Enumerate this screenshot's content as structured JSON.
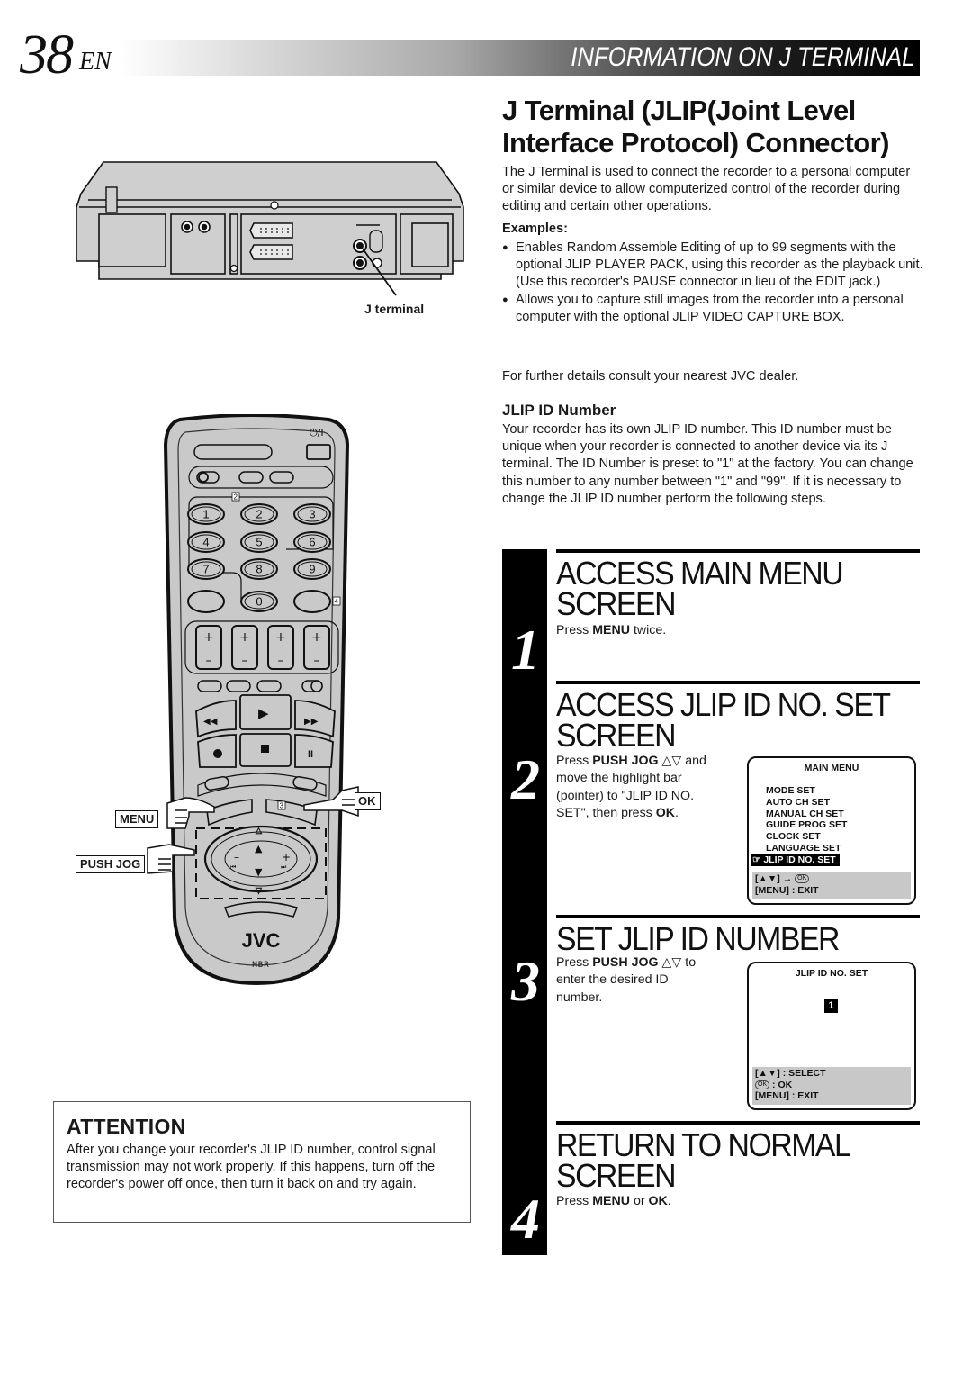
{
  "header": {
    "page_number": "38",
    "language": "EN",
    "section": "INFORMATION ON J TERMINAL"
  },
  "main": {
    "title_line1": "J Terminal (JLIP(Joint Level",
    "title_line2": "Interface Protocol) Connector)",
    "intro": "The J Terminal is used to connect the recorder to a personal computer or similar device to allow computerized control of the recorder during editing and certain other operations.",
    "examples_heading": "Examples:",
    "examples": [
      "Enables Random Assemble Editing of up to 99 segments with the optional JLIP PLAYER PACK, using this recorder as the playback unit. (Use this recorder's PAUSE connector in lieu of the EDIT jack.)",
      "Allows you to capture still images from the recorder into a personal computer with the optional JLIP VIDEO CAPTURE BOX."
    ],
    "further_details": "For further details consult your nearest JVC dealer.",
    "jlip_heading": "JLIP ID Number",
    "jlip_body": "Your recorder has its own JLIP ID number. This ID number must be unique when your recorder is connected to another device via its J terminal. The ID Number is preset to \"1\" at the factory. You can change this number to any number between \"1\" and \"99\". If it is necessary to change the JLIP ID number perform the following steps."
  },
  "steps": [
    {
      "number": "1",
      "title_line1": "ACCESS MAIN MENU",
      "title_line2": "SCREEN",
      "text_pre": "Press ",
      "text_bold1": "MENU",
      "text_post": " twice."
    },
    {
      "number": "2",
      "title_line1": "ACCESS JLIP ID NO. SET",
      "title_line2": "SCREEN",
      "line1_pre": "Press ",
      "line1_bold": "PUSH JOG",
      "line1_post": " △▽ and",
      "line2": "move the highlight bar",
      "line3": "(pointer) to \"JLIP ID NO.",
      "line4_pre": "SET\", then press ",
      "line4_bold": "OK",
      "line4_post": "."
    },
    {
      "number": "3",
      "title_line1": "SET JLIP ID NUMBER",
      "line1_pre": "Press ",
      "line1_bold": "PUSH JOG",
      "line1_post": " △▽ to",
      "line2": "enter the desired ID",
      "line3": "number."
    },
    {
      "number": "4",
      "title_line1": "RETURN TO NORMAL",
      "title_line2": "SCREEN",
      "text_pre": "Press ",
      "text_bold1": "MENU",
      "text_mid": " or ",
      "text_bold2": "OK",
      "text_post": "."
    }
  ],
  "main_menu_osd": {
    "title": "MAIN MENU",
    "items": [
      "MODE SET",
      "AUTO CH SET",
      "MANUAL CH SET",
      "GUIDE PROG SET",
      "CLOCK SET",
      "LANGUAGE SET",
      "JLIP ID NO. SET"
    ],
    "selected_index": 6,
    "pointer_icon": "☞",
    "footer_line1_keys": "[▲▼] →",
    "footer_ok": "OK",
    "footer_line2": "[MENU] : EXIT"
  },
  "jlip_set_osd": {
    "title": "JLIP ID NO. SET",
    "value": "1",
    "footer_select": "[▲▼] : SELECT",
    "footer_ok_icon": "OK",
    "footer_ok_text": " : OK",
    "footer_exit": "[MENU] : EXIT"
  },
  "illustration": {
    "j_terminal_label": "J terminal",
    "callout_menu": "MENU",
    "callout_push_jog": "PUSH JOG",
    "callout_ok": "OK",
    "remote_brand": "JVC",
    "remote_sub_brand": "MBR",
    "keypad": [
      "1",
      "2",
      "3",
      "4",
      "5",
      "6",
      "7",
      "8",
      "9",
      "0"
    ],
    "power_symbol": "⏻/I",
    "badge_2": "2",
    "badge_3": "3",
    "badge_4": "4"
  },
  "attention": {
    "title": "ATTENTION",
    "body": "After you change your recorder's JLIP ID number, control signal transmission may not work properly. If this happens, turn off the recorder's power off once, then turn it back on and try again."
  }
}
